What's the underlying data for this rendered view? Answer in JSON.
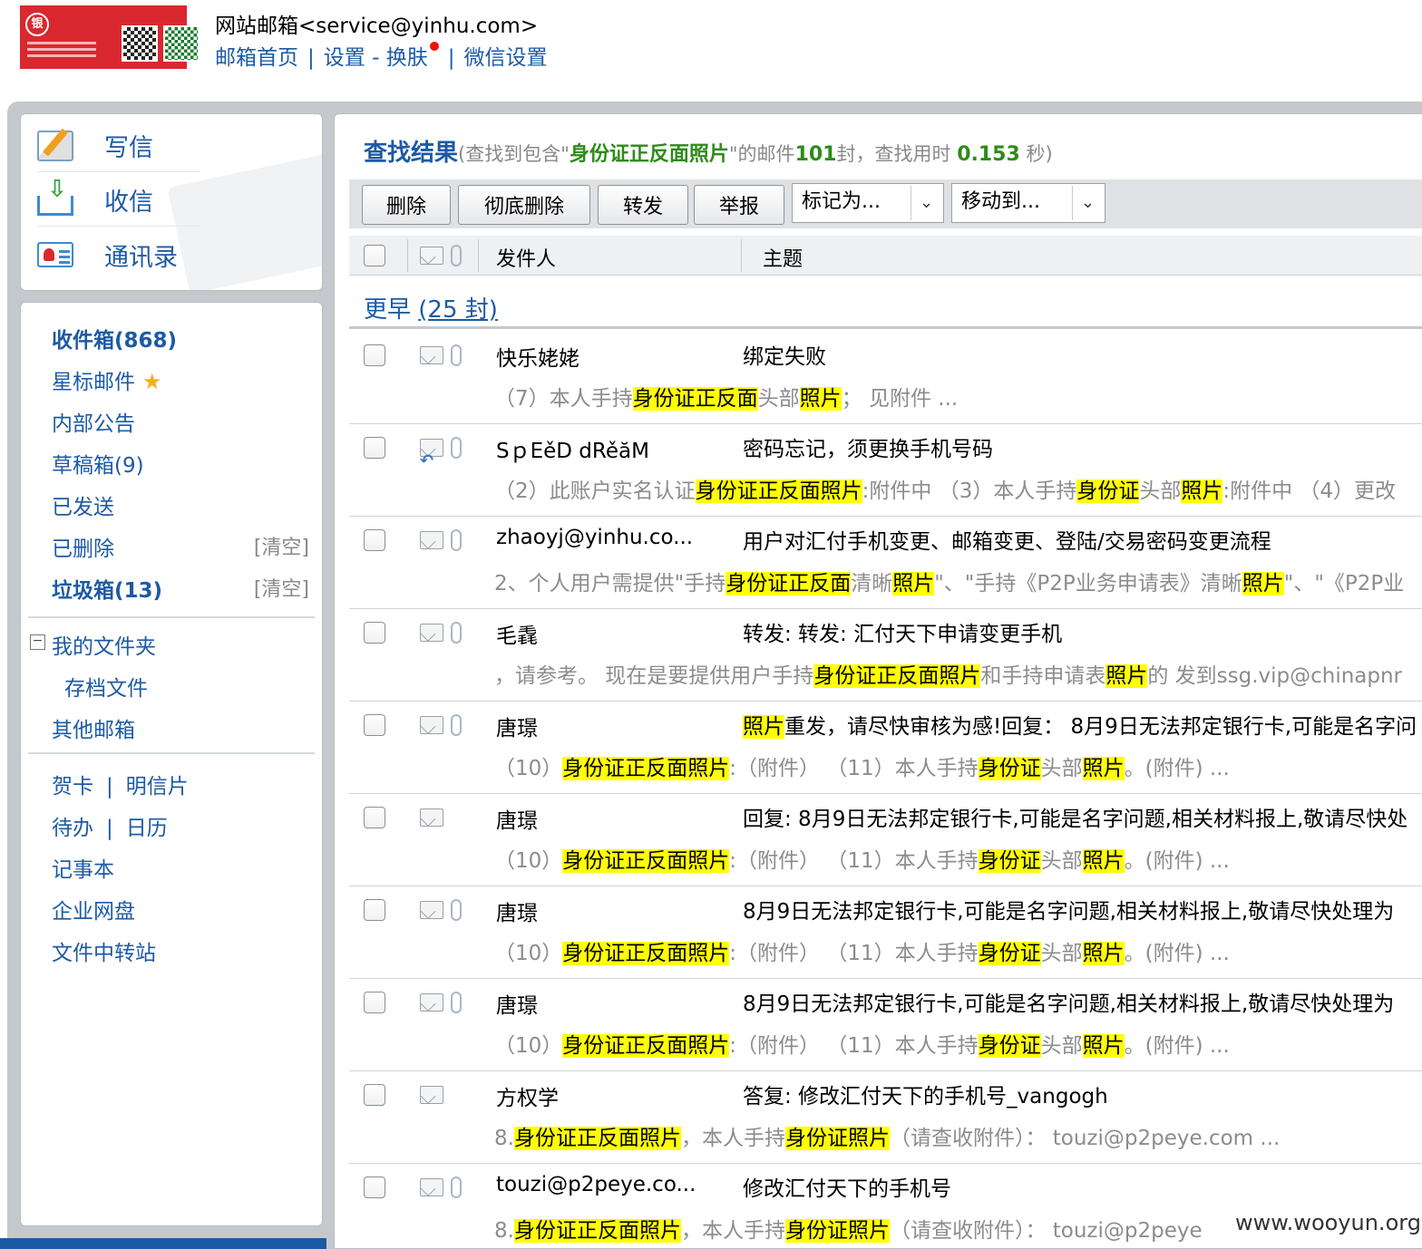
{
  "header": {
    "account_title": "网站邮箱<service@yinhu.com>",
    "links": {
      "home": "邮箱首页",
      "settings": "设置",
      "dash": "-",
      "skin": "换肤",
      "wechat": "微信设置"
    },
    "sep": "|"
  },
  "quick_actions": [
    {
      "label": "写信",
      "icon": "compose-icon"
    },
    {
      "label": "收信",
      "icon": "inbox-download-icon"
    },
    {
      "label": "通讯录",
      "icon": "contacts-icon"
    }
  ],
  "folders": {
    "inbox": "收件箱(868)",
    "starred": "星标邮件",
    "announcements": "内部公告",
    "drafts": "草稿箱(9)",
    "sent": "已发送",
    "deleted": "已删除",
    "spam": "垃圾箱(13)",
    "clear": "[清空]",
    "toggle": "⊟",
    "my_folders": "我的文件夹",
    "archive": "存档文件",
    "other_mailbox": "其他邮箱",
    "tools": {
      "greeting_card": "贺卡",
      "postcard": "明信片",
      "todo": "待办",
      "calendar": "日历",
      "notepad": "记事本",
      "netdisk": "企业网盘",
      "file_transfer": "文件中转站",
      "sep": "|"
    }
  },
  "search": {
    "title": "查找结果",
    "prefix": "(查找到包含\"",
    "keyword": "身份证正反面照片",
    "mid": "\"的邮件",
    "count": "101",
    "mid2": "封，查找用时 ",
    "time": "0.153",
    "suffix": " 秒)"
  },
  "toolbar": {
    "delete": "删除",
    "delete_forever": "彻底删除",
    "forward": "转发",
    "report": "举报",
    "mark_as": "标记为...",
    "move_to": "移动到...",
    "caret": "❯"
  },
  "list_header": {
    "sender": "发件人",
    "subject": "主题"
  },
  "group": {
    "label": "更早 ",
    "count": "(25 封)"
  },
  "mails": [
    {
      "sender": "快乐姥姥",
      "subject": [
        {
          "t": "绑定失败"
        }
      ],
      "preview": [
        {
          "t": "（7）本人手持"
        },
        {
          "t": "身份证正反面",
          "hl": true
        },
        {
          "t": "头部"
        },
        {
          "t": "照片",
          "hl": true
        },
        {
          "t": "；  见附件 ..."
        }
      ],
      "attach": true,
      "reply": false
    },
    {
      "sender": "SｐEěD dRěăM",
      "subject": [
        {
          "t": "密码忘记，须更换手机号码"
        }
      ],
      "preview": [
        {
          "t": "（2）此账户实名认证"
        },
        {
          "t": "身份证正反面照片",
          "hl": true
        },
        {
          "t": ":附件中  （3）本人手持"
        },
        {
          "t": "身份证",
          "hl": true
        },
        {
          "t": "头部"
        },
        {
          "t": "照片",
          "hl": true
        },
        {
          "t": ":附件中  （4）更改"
        }
      ],
      "attach": true,
      "reply": true
    },
    {
      "sender": "zhaoyj@yinhu.co...",
      "subject": [
        {
          "t": "用户对汇付手机变更、邮箱变更、登陆/交易密码变更流程"
        }
      ],
      "preview": [
        {
          "t": "2、个人用户需提供\"手持"
        },
        {
          "t": "身份证正反面",
          "hl": true
        },
        {
          "t": "清晰"
        },
        {
          "t": "照片",
          "hl": true
        },
        {
          "t": "\"、\"手持《P2P业务申请表》清晰"
        },
        {
          "t": "照片",
          "hl": true
        },
        {
          "t": "\"、\"《P2P业"
        }
      ],
      "attach": true,
      "reply": false
    },
    {
      "sender": "毛毳",
      "subject": [
        {
          "t": "转发: 转发: 汇付天下申请变更手机"
        }
      ],
      "preview": [
        {
          "t": "，请参考。  现在是要提供用户手持"
        },
        {
          "t": "身份证正反面照片",
          "hl": true
        },
        {
          "t": "和手持申请表"
        },
        {
          "t": "照片",
          "hl": true
        },
        {
          "t": "的  发到ssg.vip@chinapnr"
        }
      ],
      "attach": true,
      "reply": false
    },
    {
      "sender": "唐璟",
      "subject": [
        {
          "t": "照片",
          "hl": true
        },
        {
          "t": "重发，请尽快审核为感!回复：  8月9日无法邦定银行卡,可能是名字问"
        }
      ],
      "preview": [
        {
          "t": "（10）"
        },
        {
          "t": "身份证正反面照片",
          "hl": true
        },
        {
          "t": ":（附件）  （11）本人手持"
        },
        {
          "t": "身份证",
          "hl": true
        },
        {
          "t": "头部"
        },
        {
          "t": "照片",
          "hl": true
        },
        {
          "t": "。(附件) ..."
        }
      ],
      "attach": true,
      "reply": false
    },
    {
      "sender": "唐璟",
      "subject": [
        {
          "t": "回复: 8月9日无法邦定银行卡,可能是名字问题,相关材料报上,敬请尽快处"
        }
      ],
      "preview": [
        {
          "t": "（10）"
        },
        {
          "t": "身份证正反面照片",
          "hl": true
        },
        {
          "t": ":（附件）  （11）本人手持"
        },
        {
          "t": "身份证",
          "hl": true
        },
        {
          "t": "头部"
        },
        {
          "t": "照片",
          "hl": true
        },
        {
          "t": "。(附件) ..."
        }
      ],
      "attach": false,
      "reply": false
    },
    {
      "sender": "唐璟",
      "subject": [
        {
          "t": "8月9日无法邦定银行卡,可能是名字问题,相关材料报上,敬请尽快处理为"
        }
      ],
      "preview": [
        {
          "t": "（10）"
        },
        {
          "t": "身份证正反面照片",
          "hl": true
        },
        {
          "t": ":（附件）  （11）本人手持"
        },
        {
          "t": "身份证",
          "hl": true
        },
        {
          "t": "头部"
        },
        {
          "t": "照片",
          "hl": true
        },
        {
          "t": "。(附件) ..."
        }
      ],
      "attach": true,
      "reply": false
    },
    {
      "sender": "唐璟",
      "subject": [
        {
          "t": "8月9日无法邦定银行卡,可能是名字问题,相关材料报上,敬请尽快处理为"
        }
      ],
      "preview": [
        {
          "t": "（10）"
        },
        {
          "t": "身份证正反面照片",
          "hl": true
        },
        {
          "t": ":（附件）  （11）本人手持"
        },
        {
          "t": "身份证",
          "hl": true
        },
        {
          "t": "头部"
        },
        {
          "t": "照片",
          "hl": true
        },
        {
          "t": "。(附件) ..."
        }
      ],
      "attach": true,
      "reply": false
    },
    {
      "sender": "方权学",
      "subject": [
        {
          "t": "答复: 修改汇付天下的手机号_vangogh"
        }
      ],
      "preview": [
        {
          "t": "8."
        },
        {
          "t": "身份证正反面照片",
          "hl": true
        },
        {
          "t": "，本人手持"
        },
        {
          "t": "身份证照片",
          "hl": true
        },
        {
          "t": "（请查收附件）：  touzi@p2peye.com ..."
        }
      ],
      "attach": false,
      "reply": false
    },
    {
      "sender": "touzi@p2peye.co...",
      "subject": [
        {
          "t": "修改汇付天下的手机号"
        }
      ],
      "preview": [
        {
          "t": "8."
        },
        {
          "t": "身份证正反面照片",
          "hl": true
        },
        {
          "t": "，本人手持"
        },
        {
          "t": "身份证照片",
          "hl": true
        },
        {
          "t": "（请查收附件）：  touzi@p2peye"
        }
      ],
      "attach": true,
      "reply": false
    }
  ],
  "watermark": "www.wooyun.org"
}
